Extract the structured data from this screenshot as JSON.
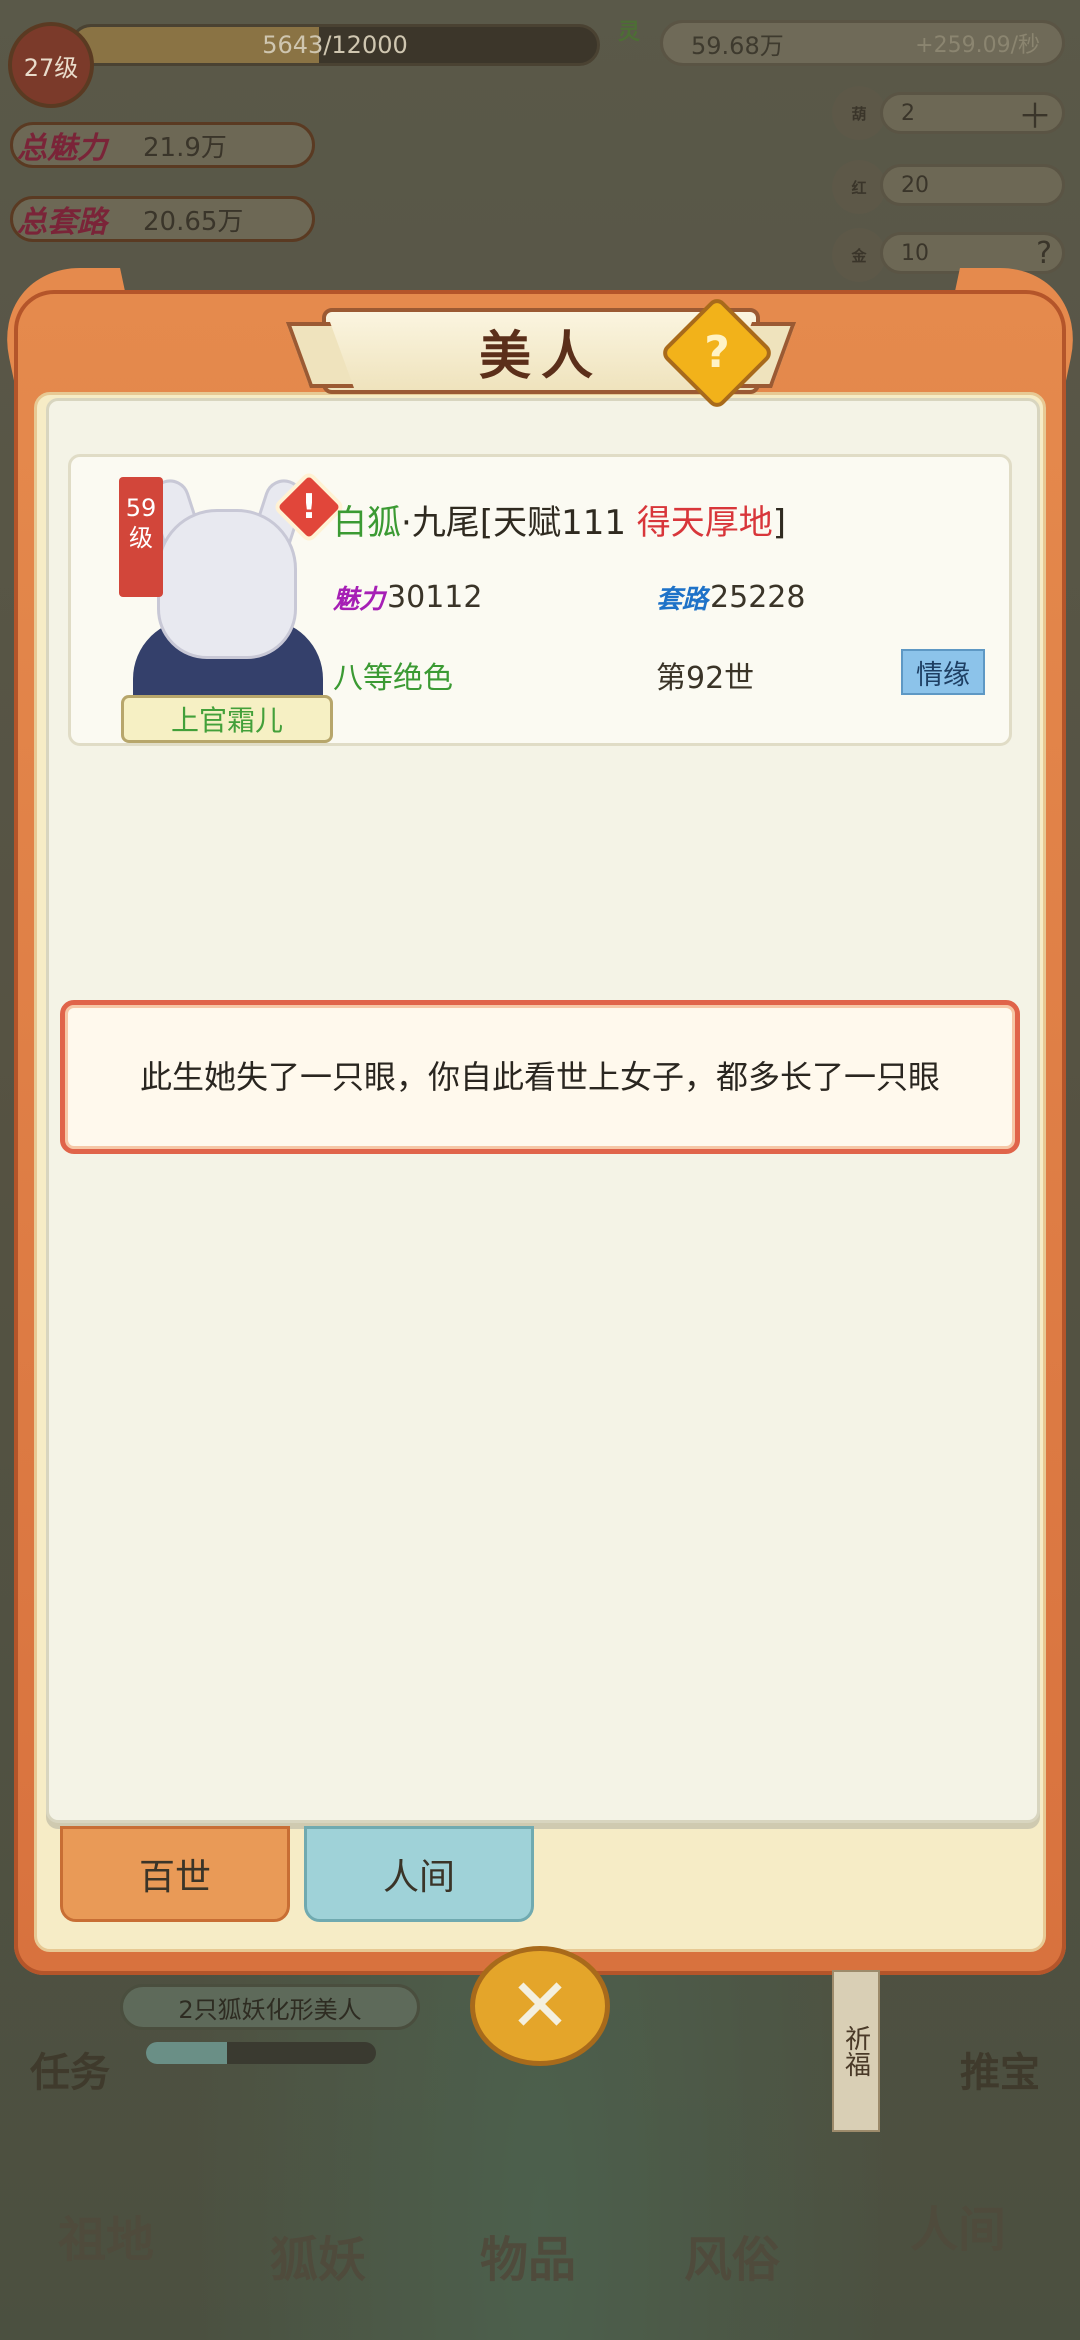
{
  "hud": {
    "level": "27级",
    "exp_text": "5643/12000",
    "exp_fraction": 0.47,
    "money_value": "59.68万",
    "money_rate": "+259.09/秒",
    "total_charm_label": "总魅力",
    "total_charm_value": "21.9万",
    "total_tricks_label": "总套路",
    "total_tricks_value": "20.65万",
    "resources": [
      {
        "icon": "gourd-icon",
        "value": "2"
      },
      {
        "icon": "red-thread-icon",
        "value": "20"
      },
      {
        "icon": "gold-icon",
        "value": "10"
      }
    ]
  },
  "modal": {
    "title": "美人",
    "help_symbol": "?",
    "beauty": {
      "level": "59级",
      "name": "上官霜儿",
      "breed": "白狐",
      "sep": "·",
      "tails": "九尾",
      "talent_prefix": "[天赋111 ",
      "talent_trait": "得天厚地",
      "talent_suffix": "]",
      "charm_label": "魅力",
      "charm_value": "30112",
      "trick_label": "套路",
      "trick_value": "25228",
      "rank": "八等绝色",
      "generation": "第92世",
      "bond_button": "情缘"
    },
    "story_text": "此生她失了一只眼，你自此看世上女子，都多长了一只眼",
    "tabs": [
      {
        "label": "百世",
        "active": true
      },
      {
        "label": "人间",
        "active": false
      }
    ]
  },
  "bottom": {
    "task_text": "2只狐妖化形美人",
    "task_label": "任务",
    "task_progress": 0.35,
    "pray_label": "祈福",
    "treasure_label": "推宝",
    "nav": [
      "祖地",
      "狐妖",
      "物品",
      "风俗",
      "人间"
    ]
  },
  "colors": {
    "frame_orange": "#e58a4d",
    "accent_green": "#3b9a33",
    "accent_red": "#d8363a",
    "bond_blue": "#8cc3ea"
  }
}
